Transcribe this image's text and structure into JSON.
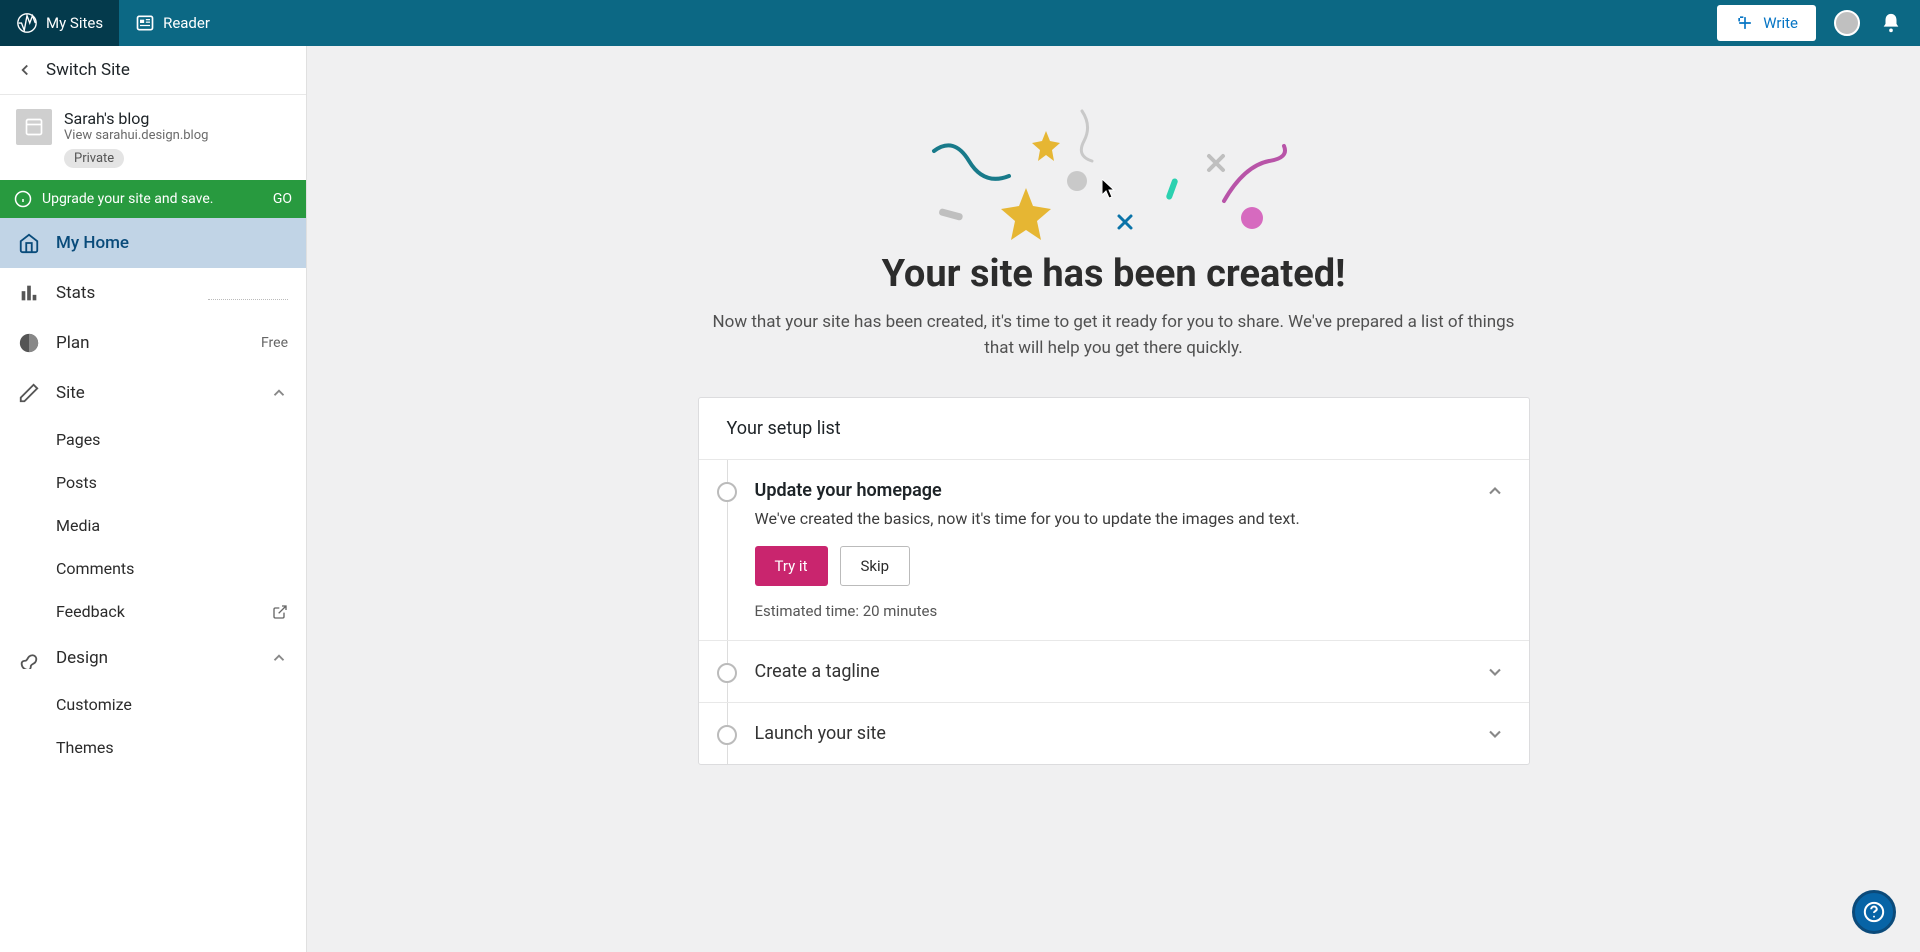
{
  "masterbar": {
    "my_sites": "My Sites",
    "reader": "Reader",
    "write": "Write"
  },
  "sidebar": {
    "switch_site": "Switch Site",
    "site_name": "Sarah's blog",
    "site_url_prefix": "View ",
    "site_url": "sarahui.design.blog",
    "private_label": "Private",
    "upgrade_text": "Upgrade your site and save.",
    "upgrade_go": "GO",
    "nav": {
      "my_home": "My Home",
      "stats": "Stats",
      "plan": "Plan",
      "plan_badge": "Free",
      "site": "Site",
      "pages": "Pages",
      "posts": "Posts",
      "media": "Media",
      "comments": "Comments",
      "feedback": "Feedback",
      "design": "Design",
      "customize": "Customize",
      "themes": "Themes"
    }
  },
  "main": {
    "title": "Your site has been created!",
    "subtitle": "Now that your site has been created, it's time to get it ready for you to share. We've prepared a list of things that will help you get there quickly.",
    "setup_header": "Your setup list",
    "tasks": [
      {
        "title": "Update your homepage",
        "desc": "We've created the basics, now it's time for you to update the images and text.",
        "try_label": "Try it",
        "skip_label": "Skip",
        "time": "Estimated time: 20 minutes",
        "expanded": true
      },
      {
        "title": "Create a tagline",
        "expanded": false
      },
      {
        "title": "Launch your site",
        "expanded": false
      }
    ]
  }
}
